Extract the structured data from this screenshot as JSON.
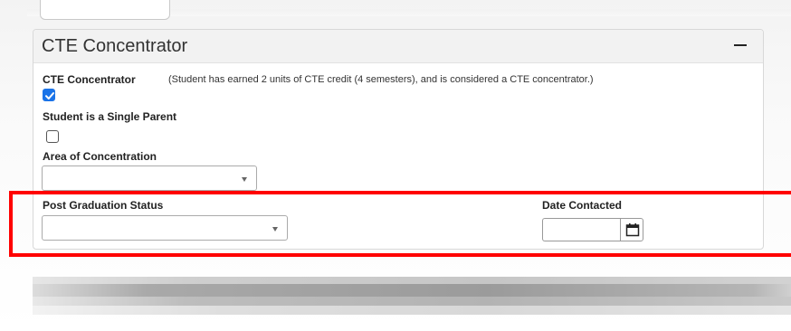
{
  "section": {
    "title": "CTE Concentrator",
    "collapse_icon": "minus-icon"
  },
  "fields": {
    "cte_concentrator": {
      "label": "CTE Concentrator",
      "description": "(Student has earned 2 units of CTE credit (4 semesters), and is considered a CTE concentrator.)",
      "checked": true
    },
    "single_parent": {
      "label": "Student is a Single Parent",
      "checked": false
    },
    "area_of_concentration": {
      "label": "Area of Concentration",
      "value": ""
    },
    "post_graduation_status": {
      "label": "Post Graduation Status",
      "value": ""
    },
    "date_contacted": {
      "label": "Date Contacted",
      "value": "",
      "icon": "calendar-icon"
    }
  },
  "colors": {
    "checkbox_checked": "#1a73e8",
    "highlight_border": "#ff0000",
    "header_bg": "#f2f2f2"
  }
}
